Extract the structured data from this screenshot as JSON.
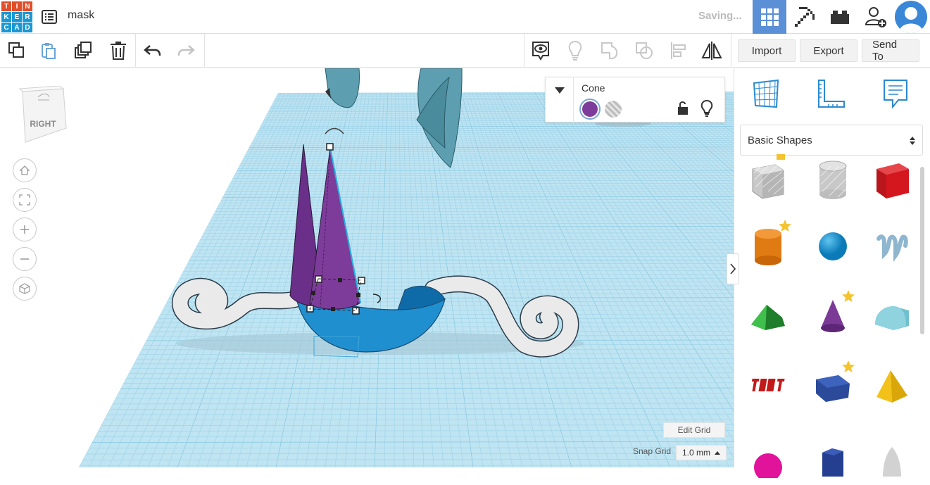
{
  "header": {
    "logo_letters": [
      "T",
      "I",
      "N",
      "K",
      "E",
      "R",
      "C",
      "A",
      "D"
    ],
    "design_name": "mask",
    "status": "Saving..."
  },
  "toolbar": {
    "import_label": "Import",
    "export_label": "Export",
    "send_to_label": "Send To"
  },
  "viewcube": {
    "face_label": "RIGHT"
  },
  "inspector": {
    "shape_name": "Cone",
    "solid_color": "#7e3c9a"
  },
  "grid": {
    "edit_grid_label": "Edit Grid",
    "snap_label": "Snap Grid",
    "snap_value": "1.0 mm"
  },
  "panel": {
    "library": "Basic Shapes"
  },
  "colors": {
    "accent_blue": "#5b8fd6",
    "workplane": "#bfe4f2",
    "grid_line": "#8fcbe3"
  }
}
